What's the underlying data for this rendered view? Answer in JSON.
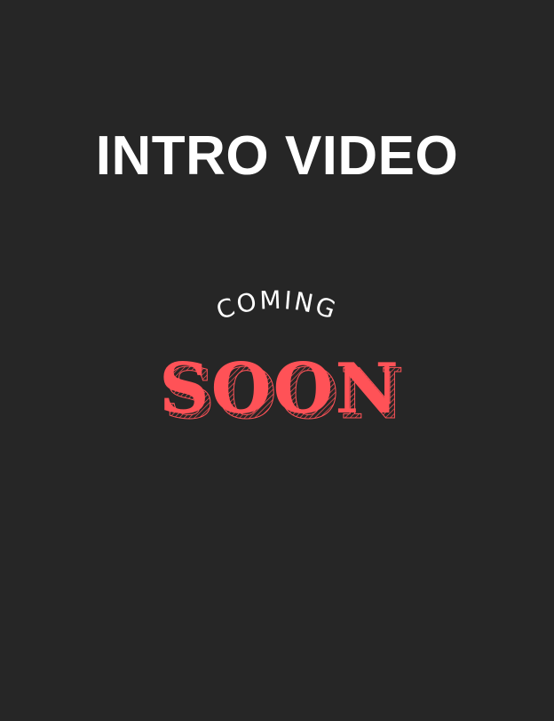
{
  "title": "INTRO VIDEO",
  "badge": {
    "top_text": "COMING",
    "main_text": "SOON",
    "accent_color": "#ff5257",
    "shadow_color": "#ff5257"
  },
  "colors": {
    "background": "#262626",
    "title": "#ffffff",
    "coming": "#ffffff"
  }
}
